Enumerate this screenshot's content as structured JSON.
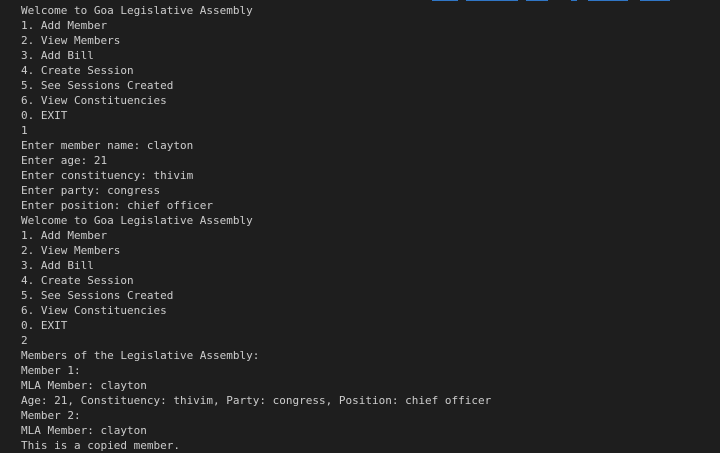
{
  "terminal": {
    "lines": [
      "Welcome to Goa Legislative Assembly",
      "1. Add Member",
      "2. View Members",
      "3. Add Bill",
      "4. Create Session",
      "5. See Sessions Created",
      "6. View Constituencies",
      "0. EXIT",
      "1",
      "Enter member name: clayton",
      "Enter age: 21",
      "Enter constituency: thivim",
      "Enter party: congress",
      "Enter position: chief officer",
      "Welcome to Goa Legislative Assembly",
      "1. Add Member",
      "2. View Members",
      "3. Add Bill",
      "4. Create Session",
      "5. See Sessions Created",
      "6. View Constituencies",
      "0. EXIT",
      "2",
      "Members of the Legislative Assembly:",
      "Member 1:",
      "MLA Member: clayton",
      "Age: 21, Constituency: thivim, Party: congress, Position: chief officer",
      "Member 2:",
      "MLA Member: clayton",
      "This is a copied member."
    ]
  },
  "colors": {
    "background": "#1e1e1e",
    "foreground": "#cccccc",
    "accent": "#3794ff"
  }
}
